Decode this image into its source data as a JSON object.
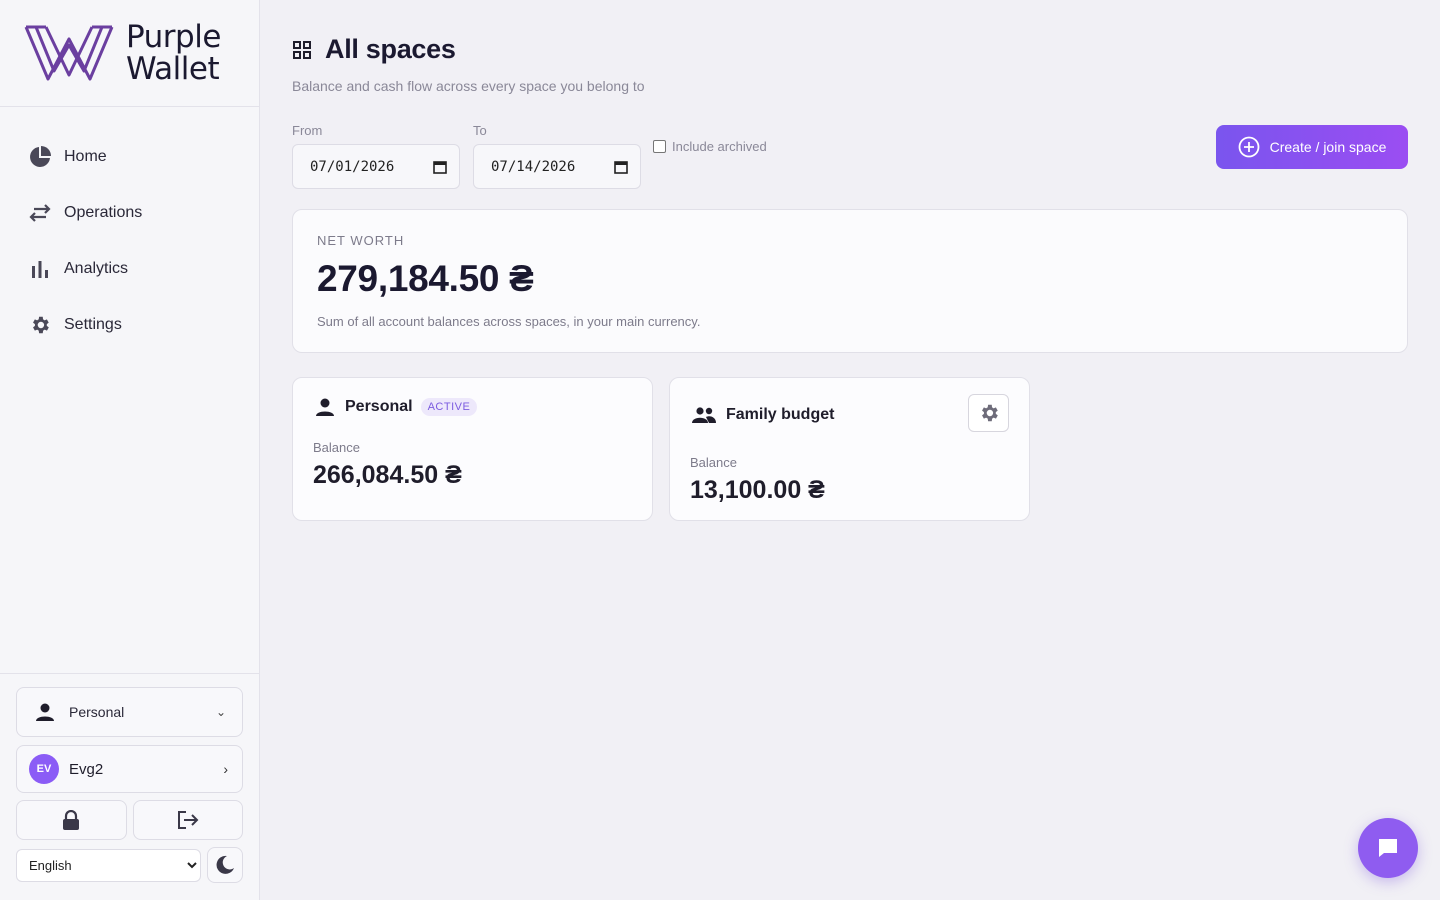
{
  "brand": {
    "line1": "Purple",
    "line2": "Wallet"
  },
  "nav": [
    {
      "label": "Home",
      "icon": "pie-chart-icon"
    },
    {
      "label": "Operations",
      "icon": "swap-arrows-icon"
    },
    {
      "label": "Analytics",
      "icon": "bar-chart-icon"
    },
    {
      "label": "Settings",
      "icon": "gear-icon"
    }
  ],
  "sidebar_bottom": {
    "space": "Personal",
    "user": {
      "initials": "EV",
      "name": "Evg2"
    },
    "language": "English"
  },
  "page": {
    "title": "All spaces",
    "subtitle": "Balance and cash flow across every space you belong to"
  },
  "filters": {
    "from_label": "From",
    "from_value": "07/01/2026",
    "to_label": "To",
    "to_value": "07/14/2026",
    "include_archived": "Include archived",
    "create_button": "Create / join space"
  },
  "net_worth": {
    "label": "NET WORTH",
    "value": "279,184.50 ₴",
    "description": "Sum of all account balances across spaces, in your main currency."
  },
  "spaces": [
    {
      "name": "Personal",
      "badge": "ACTIVE",
      "balance_label": "Balance",
      "balance": "266,084.50 ₴"
    },
    {
      "name": "Family budget",
      "balance_label": "Balance",
      "balance": "13,100.00 ₴"
    }
  ],
  "colors": {
    "accent": "#8b5cf6",
    "brand": "#6b3fa0",
    "text": "#1b1930"
  }
}
